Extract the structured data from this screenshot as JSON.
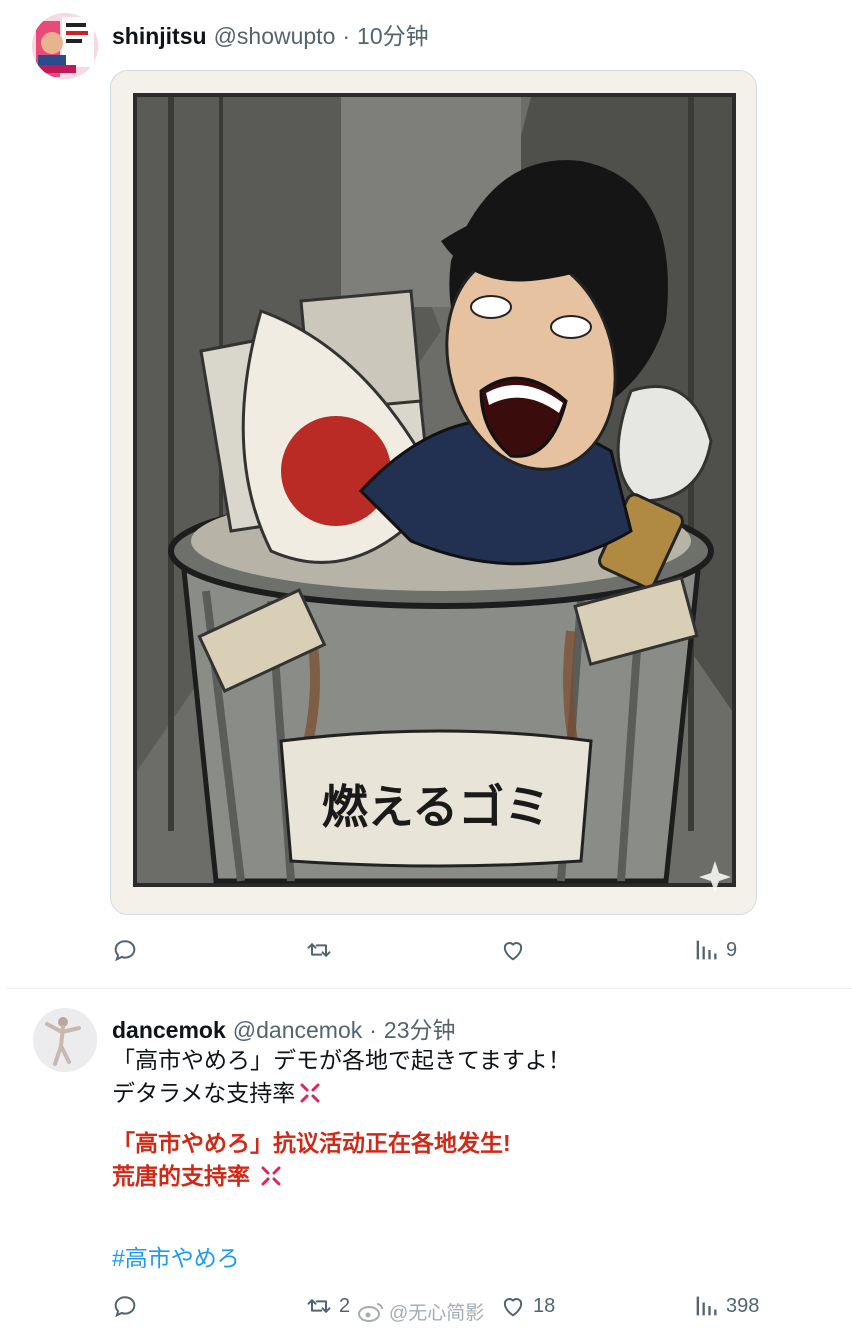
{
  "tweet1": {
    "display_name": "shinjitsu",
    "handle": "@showupto",
    "sep": "·",
    "time": "10分钟",
    "media_sign_text": "燃えるゴミ",
    "actions": {
      "reply": "",
      "retweet": "",
      "like": "",
      "views": "9"
    }
  },
  "tweet2": {
    "display_name": "dancemok",
    "handle": "@dancemok",
    "sep": "·",
    "time": "23分钟",
    "text_ja_line1": "「高市やめろ」デモが各地で起きてますよ！",
    "text_ja_line2": "デタラメな支持率",
    "text_zh_line1": "「高市やめろ」抗议活动正在各地发生!",
    "text_zh_line2": "荒唐的支持率",
    "hashtag": "#高市やめろ",
    "actions": {
      "reply": "",
      "retweet": "2",
      "like": "18",
      "views": "398"
    }
  },
  "watermark": "@无心简影",
  "colors": {
    "link": "#1d9bf0",
    "muted": "#536471",
    "accent_red": "#cf2a18",
    "anger": "#e0245e"
  },
  "icons": [
    "reply-icon",
    "retweet-icon",
    "like-icon",
    "views-icon",
    "anger-emoji-icon",
    "weibo-logo-icon"
  ]
}
